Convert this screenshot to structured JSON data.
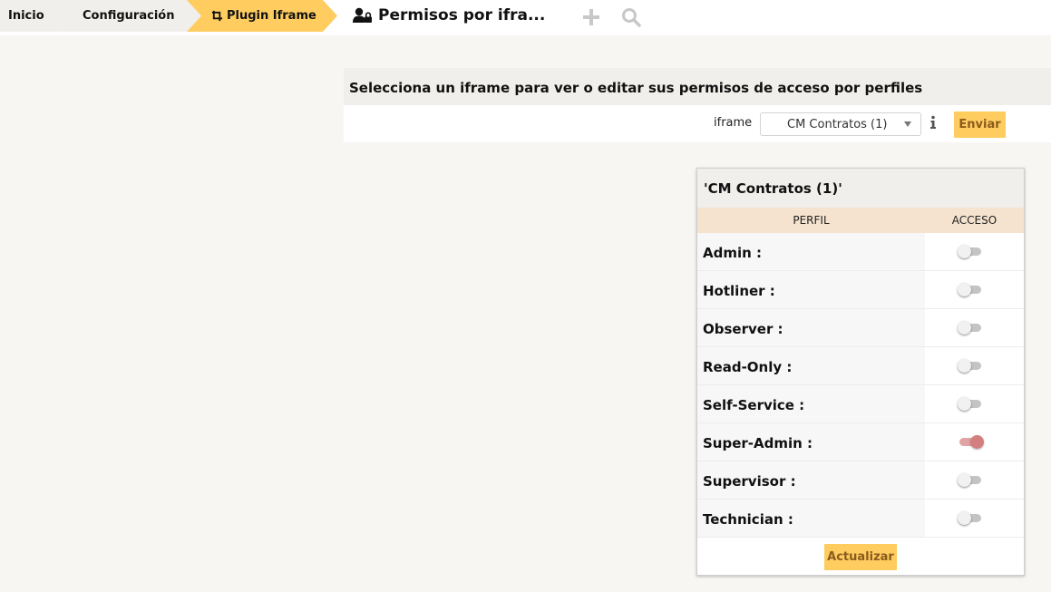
{
  "breadcrumb": {
    "items": [
      {
        "label": "Inicio"
      },
      {
        "label": "Configuración"
      },
      {
        "label": "Plugin Iframe"
      }
    ]
  },
  "page": {
    "title": "Permisos por ifra..."
  },
  "toolbar": {
    "add_icon": "plus-icon",
    "search_icon": "search-icon"
  },
  "selector": {
    "heading": "Selecciona un iframe para ver o editar sus permisos de acceso por perfiles",
    "label": "iframe",
    "selected": "CM Contratos (1)",
    "info_icon": "info-icon",
    "submit_label": "Enviar"
  },
  "permissions": {
    "title": "'CM Contratos (1)'",
    "col_profile": "PERFIL",
    "col_access": "ACCESO",
    "rows": [
      {
        "profile": "Admin :",
        "access": false
      },
      {
        "profile": "Hotliner :",
        "access": false
      },
      {
        "profile": "Observer :",
        "access": false
      },
      {
        "profile": "Read-Only :",
        "access": false
      },
      {
        "profile": "Self-Service :",
        "access": false
      },
      {
        "profile": "Super-Admin :",
        "access": true
      },
      {
        "profile": "Supervisor :",
        "access": false
      },
      {
        "profile": "Technician :",
        "access": false
      }
    ],
    "update_label": "Actualizar"
  },
  "colors": {
    "accent": "#fecc5f",
    "accent_text": "#8a5c1c",
    "header_tint": "#f5e3cf",
    "toggle_on": "#d47f7f"
  }
}
